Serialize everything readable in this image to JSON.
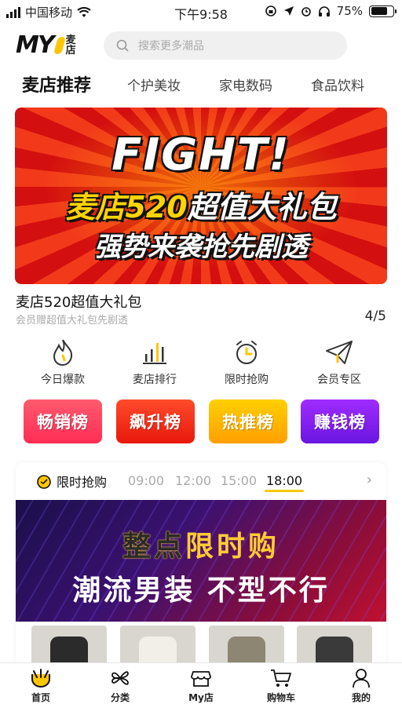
{
  "status_bar": {
    "carrier": "中国移动",
    "time": "下午9:58",
    "battery": "75%",
    "battery_level": 0.75
  },
  "header": {
    "logo_text": "MY",
    "logo_cn": "麦店",
    "search_placeholder": "搜索更多潮品"
  },
  "tabs": [
    {
      "label": "麦店推荐",
      "active": true
    },
    {
      "label": "个护美妆",
      "active": false
    },
    {
      "label": "家电数码",
      "active": false
    },
    {
      "label": "食品饮料",
      "active": false
    }
  ],
  "banner": {
    "line1": "FIGHT!",
    "line2_a": "麦店520",
    "line2_b": "超值大礼包",
    "line3": "强势来袭抢先剧透",
    "title": "麦店520超值大礼包",
    "subtitle": "会员赠超值大礼包先剧透",
    "page_indicator": "4/5"
  },
  "quick_entries": [
    {
      "label": "今日爆款",
      "icon": "flame-icon"
    },
    {
      "label": "麦店排行",
      "icon": "bar-chart-icon"
    },
    {
      "label": "限时抢购",
      "icon": "alarm-clock-icon"
    },
    {
      "label": "会员专区",
      "icon": "paper-plane-icon"
    }
  ],
  "rank_buttons": [
    {
      "label": "畅销榜",
      "color_from": "#ff5a6e",
      "color_to": "#ff2d55"
    },
    {
      "label": "飙升榜",
      "color_from": "#ff4b2b",
      "color_to": "#e8180c"
    },
    {
      "label": "热推榜",
      "color_from": "#ffd000",
      "color_to": "#ff9f00"
    },
    {
      "label": "赚钱榜",
      "color_from": "#a02cff",
      "color_to": "#6a16e0"
    }
  ],
  "flash_sale": {
    "title": "限时抢购",
    "slots": [
      {
        "time": "09:00",
        "active": false
      },
      {
        "time": "12:00",
        "active": false
      },
      {
        "time": "15:00",
        "active": false
      },
      {
        "time": "18:00",
        "active": true
      }
    ],
    "banner_line1_a": "整点",
    "banner_line1_b": "限时购",
    "banner_line2": "潮流男装 不型不行"
  },
  "bottom_nav": [
    {
      "label": "首页",
      "icon": "home-icon",
      "active": true
    },
    {
      "label": "分类",
      "icon": "category-icon",
      "active": false
    },
    {
      "label": "My店",
      "icon": "shop-icon",
      "active": false
    },
    {
      "label": "购物车",
      "icon": "cart-icon",
      "active": false
    },
    {
      "label": "我的",
      "icon": "user-icon",
      "active": false
    }
  ],
  "colors": {
    "accent": "#ffc600",
    "banner_red": "#e0201a"
  }
}
